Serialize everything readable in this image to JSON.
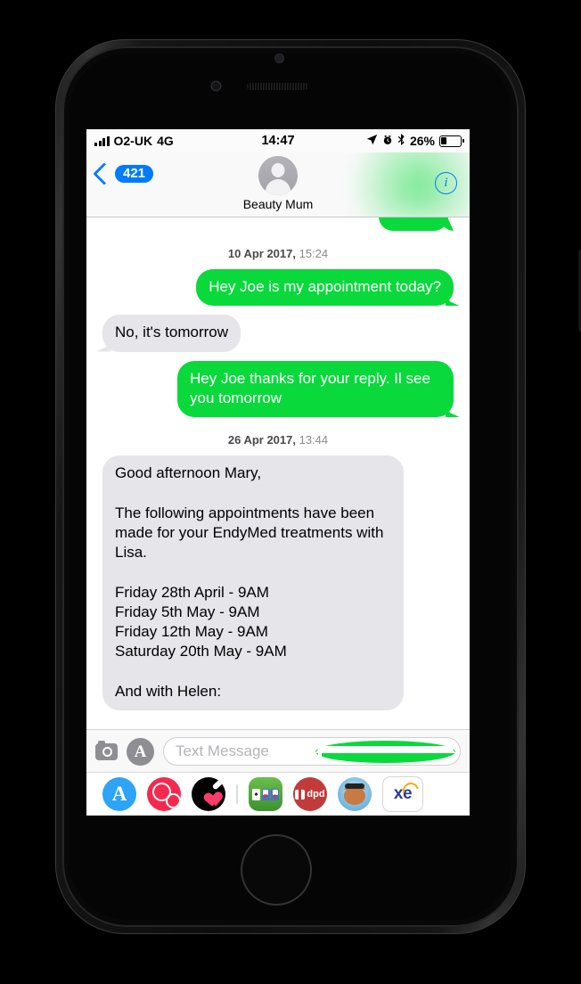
{
  "device": {
    "type": "iphone"
  },
  "status_bar": {
    "carrier": "O2-UK",
    "network": "4G",
    "time": "14:47",
    "battery_percent": "26%",
    "icons": [
      "signal-bars-icon",
      "location-arrow-icon",
      "alarm-clock-icon",
      "bluetooth-icon",
      "battery-icon"
    ]
  },
  "nav_bar": {
    "back_badge": "421",
    "contact_name": "Beauty Mum",
    "info_label": "i"
  },
  "conversation": {
    "items": [
      {
        "kind": "partial_bubble",
        "side": "out"
      },
      {
        "kind": "timestamp",
        "date": "10 Apr 2017,",
        "time": " 15:24"
      },
      {
        "kind": "message",
        "side": "out",
        "text": "Hey Joe is my appointment today?"
      },
      {
        "kind": "message",
        "side": "in",
        "text": "No, it's tomorrow"
      },
      {
        "kind": "message",
        "side": "out",
        "text": "Hey Joe thanks for your reply. Il see you tomorrow"
      },
      {
        "kind": "timestamp",
        "date": "26 Apr 2017,",
        "time": " 13:44"
      },
      {
        "kind": "message",
        "side": "in",
        "long": true,
        "text": "Good afternoon Mary,\n\nThe following appointments have been made for your EndyMed treatments with Lisa.\n\nFriday 28th April - 9AM\nFriday 5th May - 9AM\nFriday 12th May - 9AM\nSaturday 20th May - 9AM\n\nAnd with Helen:"
      }
    ]
  },
  "input_bar": {
    "camera_icon": "camera-icon",
    "appstore_icon": "app-store-icon",
    "placeholder": "Text Message",
    "send_icon": "send-arrow-icon"
  },
  "app_drawer": {
    "apps": [
      {
        "name": "app-store",
        "label": "A"
      },
      {
        "name": "search-globe-app",
        "label": ""
      },
      {
        "name": "heart-plaster-app",
        "label": ""
      },
      {
        "name": "solitaire-app",
        "label": ""
      },
      {
        "name": "dpd-app",
        "label": "dpd"
      },
      {
        "name": "cat-avatar-app",
        "label": ""
      },
      {
        "name": "xe-currency-app",
        "label": "xe"
      }
    ]
  },
  "colors": {
    "sms_green": "#0AD93C",
    "incoming_gray": "#E5E5EA",
    "ios_blue": "#007AFF"
  }
}
